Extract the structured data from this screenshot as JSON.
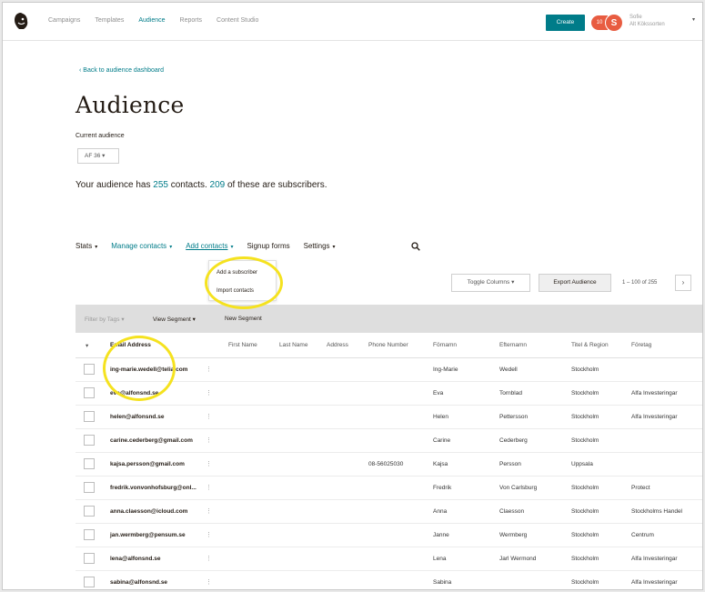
{
  "topnav": {
    "links": [
      "Campaigns",
      "Templates",
      "Audience",
      "Reports",
      "Content Studio"
    ],
    "active_link": "Audience",
    "create_label": "Create",
    "notif_count": "10",
    "avatar_initial": "S",
    "account_name": "Sofie",
    "account_org": "Alt Kökssorten",
    "colors": {
      "accent": "#007c89",
      "avatar": "#e85c41"
    }
  },
  "header": {
    "back_link": "‹  Back to audience dashboard",
    "title": "Audience",
    "current_label": "Current audience",
    "audience_value": "AF 36 ▾"
  },
  "summary": {
    "prefix": "Your audience has ",
    "contacts": "255",
    "middle": " contacts. ",
    "subscribers": "209",
    "suffix": " of these are subscribers."
  },
  "tabs": [
    {
      "label": "Stats",
      "caret": "▾"
    },
    {
      "label": "Manage contacts",
      "caret": "▾"
    },
    {
      "label": "Add contacts",
      "caret": "▾"
    },
    {
      "label": "Signup forms",
      "caret": ""
    },
    {
      "label": "Settings",
      "caret": "▾"
    }
  ],
  "dropdown": {
    "items": [
      "Add a subscriber",
      "Import contacts"
    ]
  },
  "controls": {
    "toggle_columns": "Toggle Columns ▾",
    "export_audience": "Export Audience",
    "pager_text": "1 – 100 of 255",
    "pager_next": "›"
  },
  "filterbar": {
    "filter_by_tags": "Filter by Tags ▾",
    "view_segment": "View Segment ▾",
    "new_segment": "New Segment"
  },
  "table": {
    "headers": [
      "Email Address",
      "First Name",
      "Last Name",
      "Address",
      "Phone Number",
      "Förnamn",
      "Efternamn",
      "Titel & Region",
      "Företag"
    ],
    "rows": [
      [
        "ing-marie.wedell@telia.com",
        "",
        "",
        "",
        "",
        "Ing-Marie",
        "Wedell",
        "Stockholm",
        ""
      ],
      [
        "eva@alfonsnd.se",
        "",
        "",
        "",
        "",
        "Eva",
        "Tornblad",
        "Stockholm",
        "Alfa Investeringar"
      ],
      [
        "helen@alfonsnd.se",
        "",
        "",
        "",
        "",
        "Helen",
        "Pettersson",
        "Stockholm",
        "Alfa Investeringar"
      ],
      [
        "carine.cederberg@gmail.com",
        "",
        "",
        "",
        "",
        "Carine",
        "Cederberg",
        "Stockholm",
        ""
      ],
      [
        "kajsa.persson@gmail.com",
        "",
        "",
        "",
        "08-56025030",
        "Kajsa",
        "Persson",
        "Uppsala",
        ""
      ],
      [
        "fredrik.vonvonhofsburg@onl...",
        "",
        "",
        "",
        "",
        "Fredrik",
        "Von Carlsburg",
        "Stockholm",
        "Protect"
      ],
      [
        "anna.claesson@icloud.com",
        "",
        "",
        "",
        "",
        "Anna",
        "Claesson",
        "Stockholm",
        "Stockholms Handel"
      ],
      [
        "jan.wermberg@pensum.se",
        "",
        "",
        "",
        "",
        "Janne",
        "Wermberg",
        "Stockholm",
        "Centrum"
      ],
      [
        "lena@alfonsnd.se",
        "",
        "",
        "",
        "",
        "Lena",
        "Jarl Wermond",
        "Stockholm",
        "Alfa Investeringar"
      ],
      [
        "sabina@alfonsnd.se",
        "",
        "",
        "",
        "",
        "Sabina",
        "",
        "Stockholm",
        "Alfa Investeringar"
      ]
    ]
  }
}
